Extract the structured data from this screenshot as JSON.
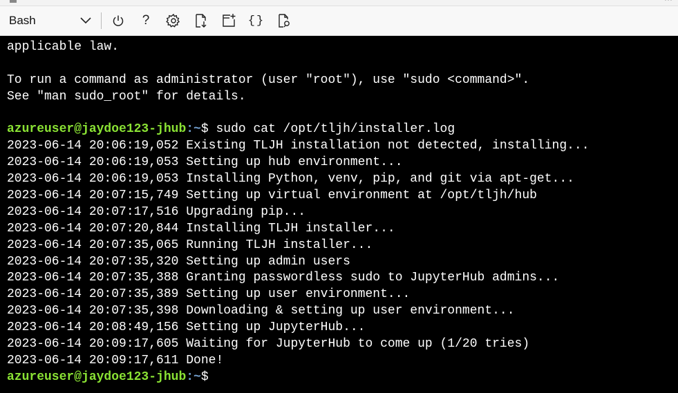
{
  "toolbar": {
    "shell_label": "Bash",
    "help_glyph": "?",
    "braces_glyph": "{}",
    "icons": [
      "power-icon",
      "help-icon",
      "settings-icon",
      "upload-download-icon",
      "new-session-icon",
      "editor-icon",
      "web-preview-icon"
    ]
  },
  "terminal": {
    "prompt_user": "azureuser@jaydoe123-jhub",
    "prompt_path": ":~",
    "prompt_symbol": "$ ",
    "lines": [
      "applicable law.",
      "",
      "To run a command as administrator (user \"root\"), use \"sudo <command>\".",
      "See \"man sudo_root\" for details.",
      ""
    ],
    "command": "sudo cat /opt/tljh/installer.log",
    "log": [
      "2023-06-14 20:06:19,052 Existing TLJH installation not detected, installing...",
      "2023-06-14 20:06:19,053 Setting up hub environment...",
      "2023-06-14 20:06:19,053 Installing Python, venv, pip, and git via apt-get...",
      "2023-06-14 20:07:15,749 Setting up virtual environment at /opt/tljh/hub",
      "2023-06-14 20:07:17,516 Upgrading pip...",
      "2023-06-14 20:07:20,844 Installing TLJH installer...",
      "2023-06-14 20:07:35,065 Running TLJH installer...",
      "2023-06-14 20:07:35,320 Setting up admin users",
      "2023-06-14 20:07:35,388 Granting passwordless sudo to JupyterHub admins...",
      "2023-06-14 20:07:35,389 Setting up user environment...",
      "2023-06-14 20:07:35,398 Downloading & setting up user environment...",
      "2023-06-14 20:08:49,156 Setting up JupyterHub...",
      "2023-06-14 20:09:17,605 Waiting for JupyterHub to come up (1/20 tries)",
      "2023-06-14 20:09:17,611 Done!"
    ]
  },
  "colors": {
    "terminal_bg": "#000000",
    "terminal_fg": "#ffffff",
    "prompt_user": "#8ae234",
    "prompt_path": "#729fcf",
    "toolbar_bg": "#f8f8f8"
  }
}
